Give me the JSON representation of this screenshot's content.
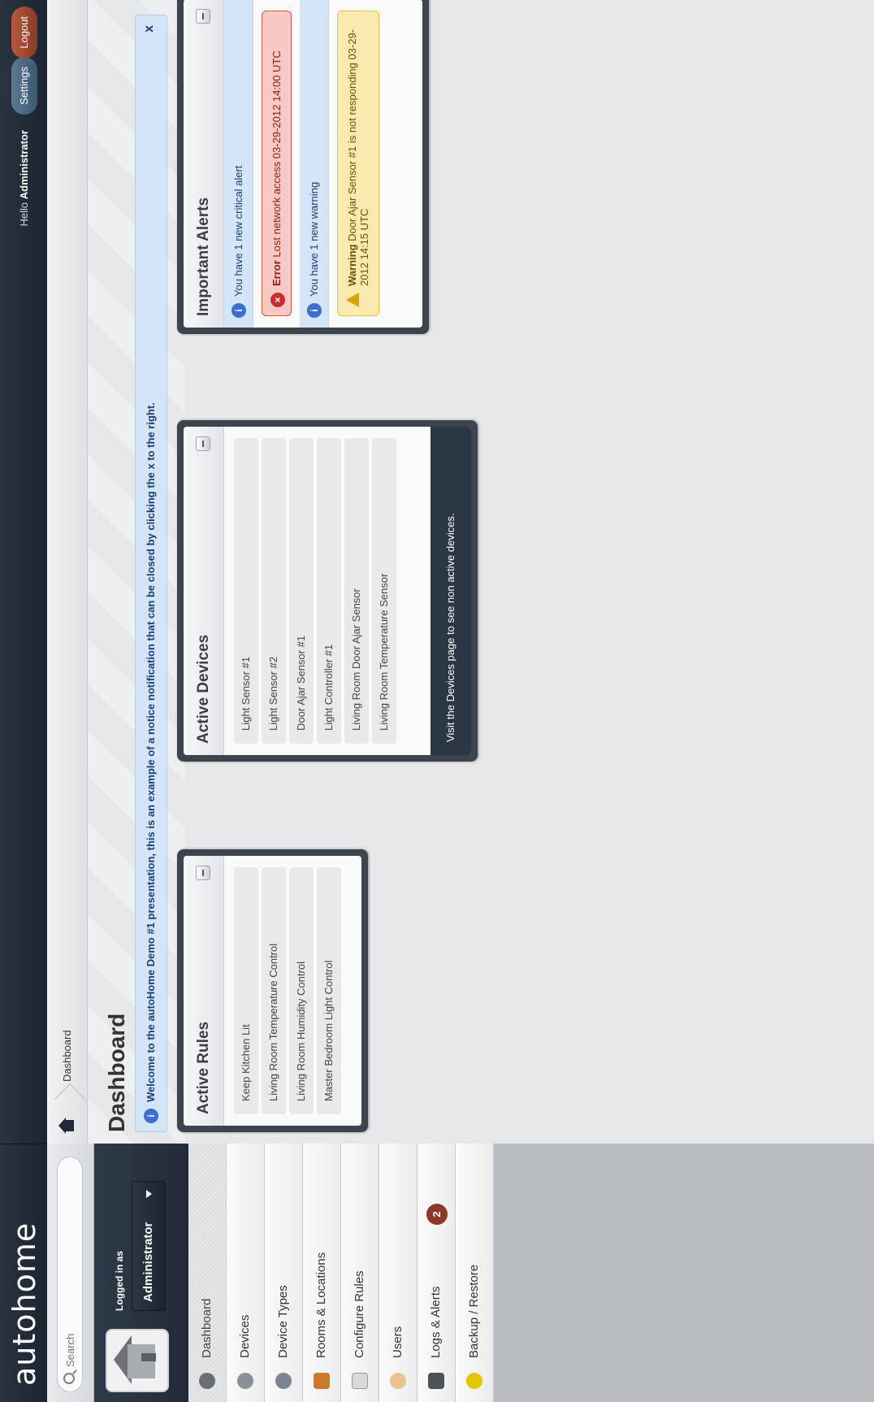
{
  "app": {
    "logo": "autohome"
  },
  "search": {
    "placeholder": "Search"
  },
  "user_panel": {
    "logged_in_label": "Logged in as",
    "user": "Administrator"
  },
  "nav": {
    "items": [
      {
        "label": "Dashboard",
        "icon": "dashboard-icon",
        "active": true
      },
      {
        "label": "Devices",
        "icon": "devices-icon"
      },
      {
        "label": "Device Types",
        "icon": "device-types-icon"
      },
      {
        "label": "Rooms & Locations",
        "icon": "rooms-icon"
      },
      {
        "label": "Configure Rules",
        "icon": "rules-icon"
      },
      {
        "label": "Users",
        "icon": "users-icon"
      },
      {
        "label": "Logs & Alerts",
        "icon": "logs-icon",
        "badge": "2"
      },
      {
        "label": "Backup / Restore",
        "icon": "backup-icon"
      }
    ]
  },
  "topbar": {
    "hello": "Hello",
    "user": "Administrator",
    "settings": "Settings",
    "logout": "Logout"
  },
  "breadcrumb": {
    "current": "Dashboard"
  },
  "page": {
    "title": "Dashboard"
  },
  "notice": {
    "text": "Welcome to the autoHome Demo #1 presentation, this is an example of a notice notification that can be closed by clicking the x to the right.",
    "close": "x"
  },
  "widgets": {
    "rules": {
      "title": "Active Rules",
      "items": [
        "Keep Kitchen Lit",
        "Living Room Temperature Control",
        "Living Room Humidity Control",
        "Master Bedroom Light Control"
      ]
    },
    "devices": {
      "title": "Active Devices",
      "items": [
        "Light Sensor #1",
        "Light Sensor #2",
        "Door Ajar Sensor #1",
        "Light Controller #1",
        "Living Room Door Ajar Sensor",
        "Living Room Temperature Sensor"
      ],
      "footer": "Visit the Devices page to see non active devices."
    },
    "alerts": {
      "title": "Important Alerts",
      "critical_summary": "You have 1 new critical alert",
      "error": {
        "label": "Error",
        "text": "Lost network access 03-29-2012 14:00 UTC"
      },
      "warning_summary": "You have 1 new warning",
      "warning": {
        "label": "Warning",
        "text": "Door Ajar Sensor #1 is not responding 03-29-2012 14:15 UTC"
      }
    }
  },
  "colors": {
    "navy": "#1b2430",
    "error": "#c9302c",
    "warning": "#d9a400",
    "info": "#3d6fd0"
  }
}
